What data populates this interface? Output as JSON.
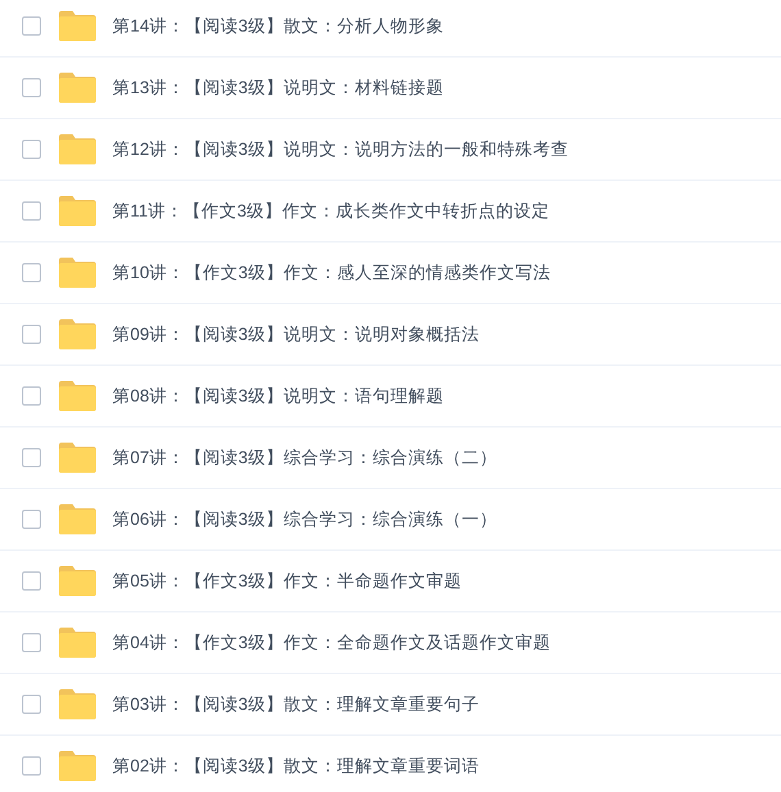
{
  "files": [
    {
      "name": "第14讲：【阅读3级】散文：分析人物形象",
      "checked": false
    },
    {
      "name": "第13讲：【阅读3级】说明文：材料链接题",
      "checked": false
    },
    {
      "name": "第12讲：【阅读3级】说明文：说明方法的一般和特殊考查",
      "checked": false
    },
    {
      "name": "第11讲：【作文3级】作文：成长类作文中转折点的设定",
      "checked": false
    },
    {
      "name": "第10讲：【作文3级】作文：感人至深的情感类作文写法",
      "checked": false
    },
    {
      "name": "第09讲：【阅读3级】说明文：说明对象概括法",
      "checked": false
    },
    {
      "name": "第08讲：【阅读3级】说明文：语句理解题",
      "checked": false
    },
    {
      "name": "第07讲：【阅读3级】综合学习：综合演练（二）",
      "checked": false
    },
    {
      "name": "第06讲：【阅读3级】综合学习：综合演练（一）",
      "checked": false
    },
    {
      "name": "第05讲：【作文3级】作文：半命题作文审题",
      "checked": false
    },
    {
      "name": "第04讲：【作文3级】作文：全命题作文及话题作文审题",
      "checked": false
    },
    {
      "name": "第03讲：【阅读3级】散文：理解文章重要句子",
      "checked": false
    },
    {
      "name": "第02讲：【阅读3级】散文：理解文章重要词语",
      "checked": false
    }
  ]
}
